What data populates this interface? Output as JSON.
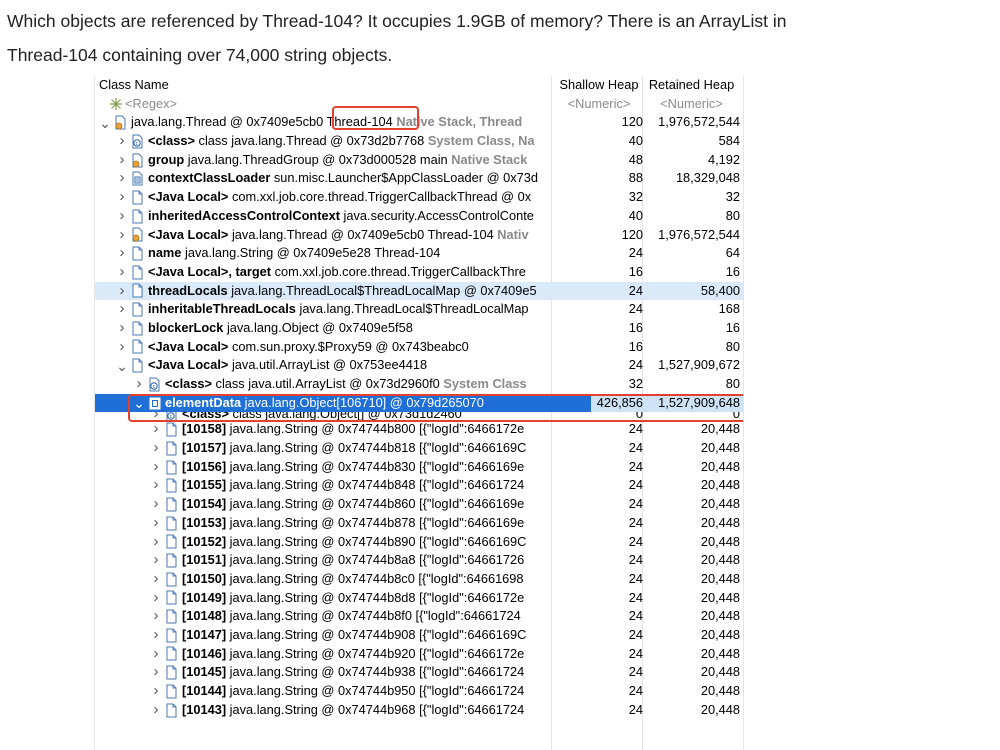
{
  "intro": {
    "line1": "Which objects are referenced by Thread-104? It occupies 1.9GB of memory? There is an ArrayList in",
    "line2": "Thread-104 containing over 74,000 string objects."
  },
  "columns": {
    "name": "Class Name",
    "shallow": "Shallow Heap",
    "retained": "Retained Heap"
  },
  "filter": {
    "name": "<Regex>",
    "shallow": "<Numeric>",
    "retained": "<Numeric>"
  },
  "rows": [
    {
      "name": "thread-root",
      "depth": 0,
      "twisty": "open",
      "icon": "thread",
      "parts": [
        {
          "t": "java.lang.Thread @ 0x7409e5cb0  Thread-104 "
        },
        {
          "t": "Native Stack, Thread",
          "g": 1
        }
      ],
      "s": "120",
      "r": "1,976,572,544"
    },
    {
      "name": "class-ref",
      "depth": 1,
      "twisty": "closed",
      "icon": "class",
      "parts": [
        {
          "t": "<class>",
          "b": 1
        },
        {
          "t": " class java.lang.Thread @ 0x73d2b7768 "
        },
        {
          "t": "System Class, Na",
          "g": 1
        }
      ],
      "s": "40",
      "r": "584"
    },
    {
      "name": "group-ref",
      "depth": 1,
      "twisty": "closed",
      "icon": "thread",
      "parts": [
        {
          "t": "group",
          "b": 1
        },
        {
          "t": " java.lang.ThreadGroup @ 0x73d000528  main "
        },
        {
          "t": "Native Stack",
          "g": 1
        }
      ],
      "s": "48",
      "r": "4,192"
    },
    {
      "name": "context-classloader-ref",
      "depth": 1,
      "twisty": "closed",
      "icon": "loader",
      "parts": [
        {
          "t": "contextClassLoader",
          "b": 1
        },
        {
          "t": " sun.misc.Launcher$AppClassLoader @ 0x73d"
        }
      ],
      "s": "88",
      "r": "18,329,048"
    },
    {
      "name": "java-local-callback-thread",
      "depth": 1,
      "twisty": "closed",
      "icon": "obj",
      "parts": [
        {
          "t": "<Java Local>",
          "b": 1
        },
        {
          "t": " com.xxl.job.core.thread.TriggerCallbackThread @ 0x"
        }
      ],
      "s": "32",
      "r": "32"
    },
    {
      "name": "inherited-acc-ref",
      "depth": 1,
      "twisty": "closed",
      "icon": "obj",
      "parts": [
        {
          "t": "inheritedAccessControlContext",
          "b": 1
        },
        {
          "t": " java.security.AccessControlConte"
        }
      ],
      "s": "40",
      "r": "80"
    },
    {
      "name": "java-local-thread",
      "depth": 1,
      "twisty": "closed",
      "icon": "thread",
      "parts": [
        {
          "t": "<Java Local>",
          "b": 1
        },
        {
          "t": " java.lang.Thread @ 0x7409e5cb0  Thread-104 "
        },
        {
          "t": "Nativ",
          "g": 1
        }
      ],
      "s": "120",
      "r": "1,976,572,544"
    },
    {
      "name": "name-ref",
      "depth": 1,
      "twisty": "closed",
      "icon": "obj",
      "parts": [
        {
          "t": "name",
          "b": 1
        },
        {
          "t": " java.lang.String @ 0x7409e5e28  Thread-104"
        }
      ],
      "s": "24",
      "r": "64"
    },
    {
      "name": "java-local-target-ref",
      "depth": 1,
      "twisty": "closed",
      "icon": "obj",
      "parts": [
        {
          "t": "<Java Local>, target",
          "b": 1
        },
        {
          "t": " com.xxl.job.core.thread.TriggerCallbackThre"
        }
      ],
      "s": "16",
      "r": "16"
    },
    {
      "name": "thread-locals-ref",
      "depth": 1,
      "twisty": "closed",
      "icon": "obj",
      "sel": "light",
      "parts": [
        {
          "t": "threadLocals",
          "b": 1
        },
        {
          "t": " java.lang.ThreadLocal$ThreadLocalMap @ 0x7409e5"
        }
      ],
      "s": "24",
      "r": "58,400"
    },
    {
      "name": "inheritable-thread-locals-ref",
      "depth": 1,
      "twisty": "closed",
      "icon": "obj",
      "parts": [
        {
          "t": "inheritableThreadLocals",
          "b": 1
        },
        {
          "t": " java.lang.ThreadLocal$ThreadLocalMap"
        }
      ],
      "s": "24",
      "r": "168"
    },
    {
      "name": "blocker-lock-ref",
      "depth": 1,
      "twisty": "closed",
      "icon": "obj",
      "parts": [
        {
          "t": "blockerLock",
          "b": 1
        },
        {
          "t": " java.lang.Object @ 0x7409e5f58"
        }
      ],
      "s": "16",
      "r": "16"
    },
    {
      "name": "java-local-proxy-ref",
      "depth": 1,
      "twisty": "closed",
      "icon": "obj",
      "parts": [
        {
          "t": "<Java Local>",
          "b": 1
        },
        {
          "t": " com.sun.proxy.$Proxy59 @ 0x743beabc0"
        }
      ],
      "s": "16",
      "r": "80"
    },
    {
      "name": "java-local-arraylist",
      "depth": 1,
      "twisty": "open",
      "icon": "obj",
      "parts": [
        {
          "t": "<Java Local>",
          "b": 1
        },
        {
          "t": " java.util.ArrayList @ 0x753ee4418"
        }
      ],
      "s": "24",
      "r": "1,527,909,672"
    },
    {
      "name": "arraylist-class-ref",
      "depth": 2,
      "twisty": "closed",
      "icon": "class",
      "parts": [
        {
          "t": "<class>",
          "b": 1
        },
        {
          "t": " class java.util.ArrayList @ 0x73d2960f0 "
        },
        {
          "t": "System Class",
          "g": 1
        }
      ],
      "s": "32",
      "r": "80"
    },
    {
      "name": "element-data-array",
      "depth": 2,
      "twisty": "open",
      "icon": "array",
      "sel": "dark",
      "parts": [
        {
          "t": "elementData",
          "b": 1
        },
        {
          "t": " java.lang.Object[106710] @ 0x79d265070"
        }
      ],
      "s": "426,856",
      "r": "1,527,909,648"
    },
    {
      "name": "element-data-class-ref",
      "depth": 3,
      "twisty": "closed",
      "icon": "class",
      "clip": 1,
      "parts": [
        {
          "t": "<class>",
          "b": 1
        },
        {
          "t": " class java.lang.Object[] @ 0x73d1d2460"
        }
      ],
      "s": "0",
      "r": "0"
    },
    {
      "name": "element-10158",
      "depth": 3,
      "twisty": "closed",
      "icon": "obj",
      "parts": [
        {
          "t": "[10158]",
          "b": 1
        },
        {
          "t": " java.lang.String @ 0x74744b800  [{\"logId\":6466172е"
        }
      ],
      "s": "24",
      "r": "20,448"
    },
    {
      "name": "element-10157",
      "depth": 3,
      "twisty": "closed",
      "icon": "obj",
      "parts": [
        {
          "t": "[10157]",
          "b": 1
        },
        {
          "t": " java.lang.String @ 0x74744b818  [{\"logId\":6466169C"
        }
      ],
      "s": "24",
      "r": "20,448"
    },
    {
      "name": "element-10156",
      "depth": 3,
      "twisty": "closed",
      "icon": "obj",
      "parts": [
        {
          "t": "[10156]",
          "b": 1
        },
        {
          "t": " java.lang.String @ 0x74744b830  [{\"logId\":6466169е"
        }
      ],
      "s": "24",
      "r": "20,448"
    },
    {
      "name": "element-10155",
      "depth": 3,
      "twisty": "closed",
      "icon": "obj",
      "parts": [
        {
          "t": "[10155]",
          "b": 1
        },
        {
          "t": " java.lang.String @ 0x74744b848  [{\"logId\":64661724"
        }
      ],
      "s": "24",
      "r": "20,448"
    },
    {
      "name": "element-10154",
      "depth": 3,
      "twisty": "closed",
      "icon": "obj",
      "parts": [
        {
          "t": "[10154]",
          "b": 1
        },
        {
          "t": " java.lang.String @ 0x74744b860  [{\"logId\":6466169е"
        }
      ],
      "s": "24",
      "r": "20,448"
    },
    {
      "name": "element-10153",
      "depth": 3,
      "twisty": "closed",
      "icon": "obj",
      "parts": [
        {
          "t": "[10153]",
          "b": 1
        },
        {
          "t": " java.lang.String @ 0x74744b878  [{\"logId\":6466169е"
        }
      ],
      "s": "24",
      "r": "20,448"
    },
    {
      "name": "element-10152",
      "depth": 3,
      "twisty": "closed",
      "icon": "obj",
      "parts": [
        {
          "t": "[10152]",
          "b": 1
        },
        {
          "t": " java.lang.String @ 0x74744b890  [{\"logId\":6466169C"
        }
      ],
      "s": "24",
      "r": "20,448"
    },
    {
      "name": "element-10151",
      "depth": 3,
      "twisty": "closed",
      "icon": "obj",
      "parts": [
        {
          "t": "[10151]",
          "b": 1
        },
        {
          "t": " java.lang.String @ 0x74744b8a8  [{\"logId\":64661726"
        }
      ],
      "s": "24",
      "r": "20,448"
    },
    {
      "name": "element-10150",
      "depth": 3,
      "twisty": "closed",
      "icon": "obj",
      "parts": [
        {
          "t": "[10150]",
          "b": 1
        },
        {
          "t": " java.lang.String @ 0x74744b8c0  [{\"logId\":64661698"
        }
      ],
      "s": "24",
      "r": "20,448"
    },
    {
      "name": "element-10149",
      "depth": 3,
      "twisty": "closed",
      "icon": "obj",
      "parts": [
        {
          "t": "[10149]",
          "b": 1
        },
        {
          "t": " java.lang.String @ 0x74744b8d8  [{\"logId\":6466172е"
        }
      ],
      "s": "24",
      "r": "20,448"
    },
    {
      "name": "element-10148",
      "depth": 3,
      "twisty": "closed",
      "icon": "obj",
      "parts": [
        {
          "t": "[10148]",
          "b": 1
        },
        {
          "t": " java.lang.String @ 0x74744b8f0  [{\"logId\":64661724"
        }
      ],
      "s": "24",
      "r": "20,448"
    },
    {
      "name": "element-10147",
      "depth": 3,
      "twisty": "closed",
      "icon": "obj",
      "parts": [
        {
          "t": "[10147]",
          "b": 1
        },
        {
          "t": " java.lang.String @ 0x74744b908  [{\"logId\":6466169C"
        }
      ],
      "s": "24",
      "r": "20,448"
    },
    {
      "name": "element-10146",
      "depth": 3,
      "twisty": "closed",
      "icon": "obj",
      "parts": [
        {
          "t": "[10146]",
          "b": 1
        },
        {
          "t": " java.lang.String @ 0x74744b920  [{\"logId\":6466172е"
        }
      ],
      "s": "24",
      "r": "20,448"
    },
    {
      "name": "element-10145",
      "depth": 3,
      "twisty": "closed",
      "icon": "obj",
      "parts": [
        {
          "t": "[10145]",
          "b": 1
        },
        {
          "t": " java.lang.String @ 0x74744b938  [{\"logId\":64661724"
        }
      ],
      "s": "24",
      "r": "20,448"
    },
    {
      "name": "element-10144",
      "depth": 3,
      "twisty": "closed",
      "icon": "obj",
      "parts": [
        {
          "t": "[10144]",
          "b": 1
        },
        {
          "t": " java.lang.String @ 0x74744b950  [{\"logId\":64661724"
        }
      ],
      "s": "24",
      "r": "20,448"
    },
    {
      "name": "element-10143",
      "depth": 3,
      "twisty": "closed",
      "icon": "obj",
      "parts": [
        {
          "t": "[10143]",
          "b": 1
        },
        {
          "t": " java.lang.String @ 0x74744b968  [{\"logId\":64661724"
        }
      ],
      "s": "24",
      "r": "20,448"
    }
  ],
  "colors": {
    "selection_dark": "#1f6fd6",
    "selection_light": "#dbeaf8",
    "highlight_box": "#e3402f",
    "muted_text": "#8a8a8a"
  }
}
